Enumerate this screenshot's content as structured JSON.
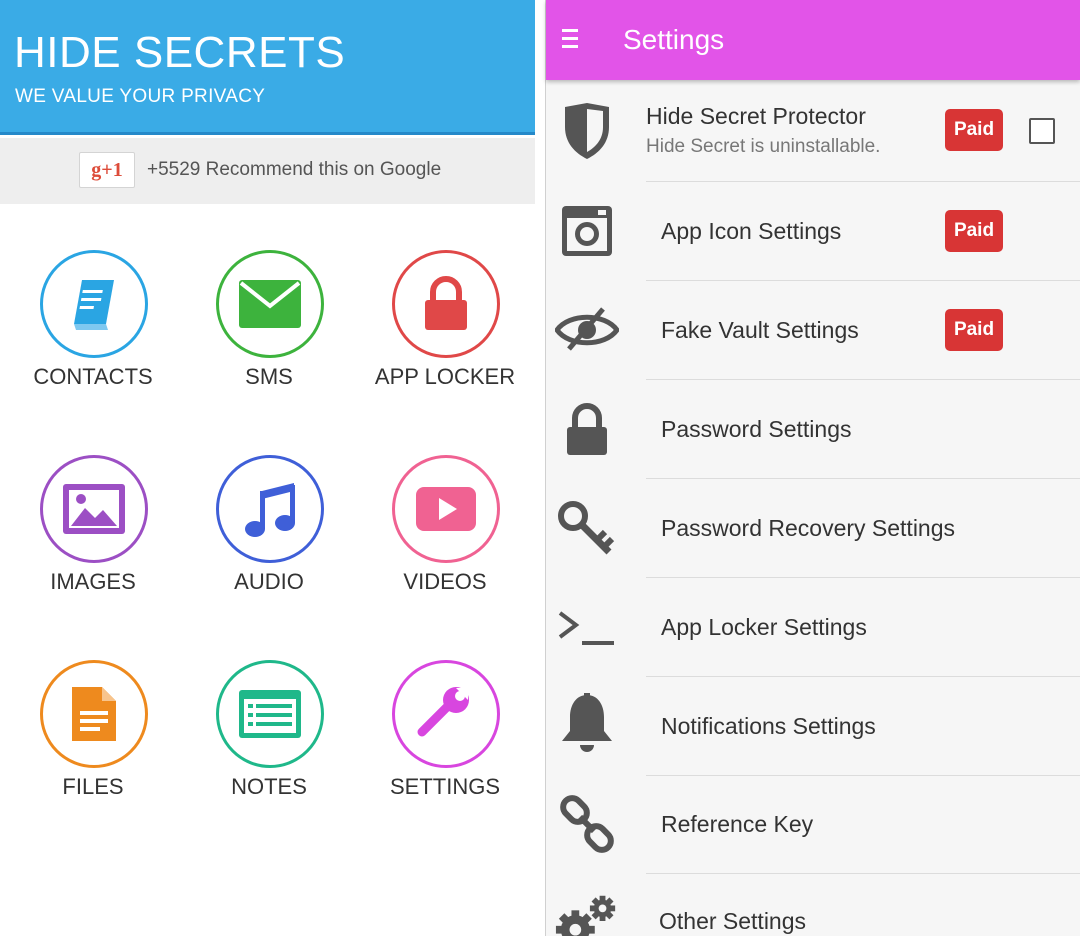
{
  "left_app": {
    "title": "HIDE SECRETS",
    "tagline": "WE VALUE YOUR PRIVACY",
    "google_button": "g+1",
    "recommend_text": "+5529 Recommend this on Google",
    "tiles": [
      {
        "label": "CONTACTS",
        "icon": "contacts-book-icon",
        "color": "#2aa5e3"
      },
      {
        "label": "SMS",
        "icon": "envelope-icon",
        "color": "#3db33d"
      },
      {
        "label": "APP LOCKER",
        "icon": "lock-icon",
        "color": "#e04848"
      },
      {
        "label": "IMAGES",
        "icon": "image-icon",
        "color": "#9c4fc4"
      },
      {
        "label": "AUDIO",
        "icon": "music-note-icon",
        "color": "#3f5fd8"
      },
      {
        "label": "VIDEOS",
        "icon": "video-play-icon",
        "color": "#f06292"
      },
      {
        "label": "FILES",
        "icon": "document-icon",
        "color": "#ee8a1e"
      },
      {
        "label": "NOTES",
        "icon": "notes-icon",
        "color": "#1fb88a"
      },
      {
        "label": "SETTINGS",
        "icon": "wrench-icon",
        "color": "#d846df"
      }
    ]
  },
  "settings_app": {
    "title": "Settings",
    "accent_color": "#e254e8",
    "paid_label": "Paid",
    "items": [
      {
        "title": "Hide Secret Protector",
        "subtitle": "Hide Secret is uninstallable.",
        "icon": "shield-icon",
        "paid": true,
        "checkbox": true
      },
      {
        "title": "App Icon Settings",
        "icon": "camera-icon",
        "paid": true
      },
      {
        "title": "Fake Vault Settings",
        "icon": "eye-off-icon",
        "paid": true
      },
      {
        "title": "Password Settings",
        "icon": "lock-icon",
        "paid": false
      },
      {
        "title": "Password Recovery Settings",
        "icon": "key-icon",
        "paid": false
      },
      {
        "title": "App Locker Settings",
        "icon": "terminal-icon",
        "paid": false
      },
      {
        "title": "Notifications Settings",
        "icon": "bell-icon",
        "paid": false
      },
      {
        "title": "Reference Key",
        "icon": "link-icon",
        "paid": false
      },
      {
        "title": "Other Settings",
        "icon": "gears-icon",
        "paid": false
      }
    ]
  }
}
